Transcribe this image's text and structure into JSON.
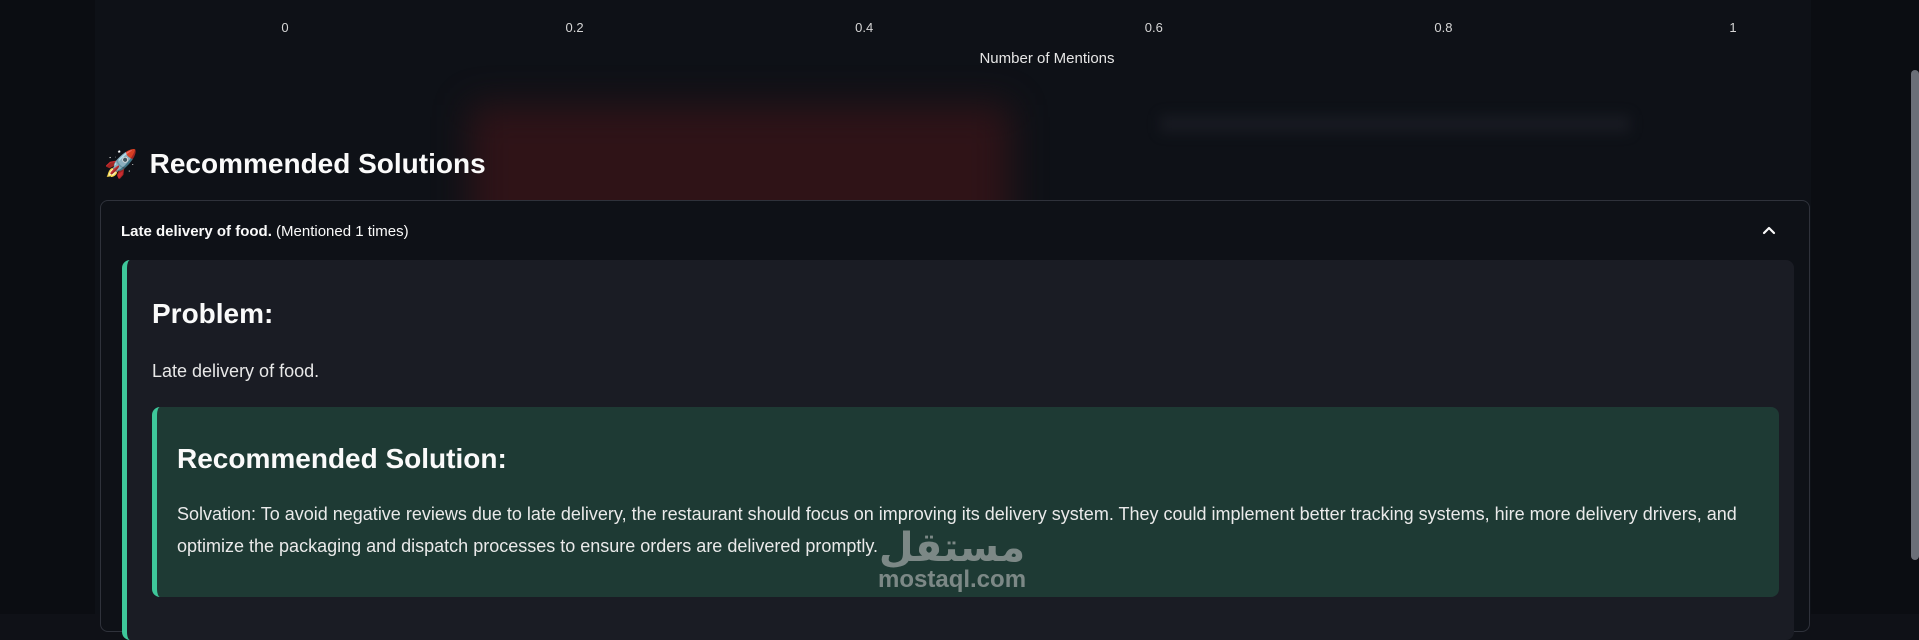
{
  "chart_data": {
    "type": "bar",
    "xlabel": "Number of Mentions",
    "xticks": [
      "0",
      "0.2",
      "0.4",
      "0.6",
      "0.8",
      "1"
    ],
    "xlim": [
      0,
      1
    ]
  },
  "section": {
    "icon": "rocket-icon",
    "title": "Recommended Solutions"
  },
  "expander": {
    "title_bold": "Late delivery of food.",
    "title_rest": " (Mentioned 1 times)",
    "chevron": "chevron-up-icon"
  },
  "problem": {
    "heading": "Problem:",
    "text": "Late delivery of food."
  },
  "solution": {
    "heading": "Recommended Solution:",
    "text": "Solvation: To avoid negative reviews due to late delivery, the restaurant should focus on improving its delivery system. They could implement better tracking systems, hire more delivery drivers, and optimize the packaging and dispatch processes to ensure orders are delivered promptly."
  },
  "watermark": {
    "arabic": "مستقل",
    "latin": "mostaql.com"
  },
  "colors": {
    "background": "#0e1117",
    "accent": "#3ec79a",
    "card": "#1a1c24",
    "solution_bg": "#1e3a34"
  }
}
